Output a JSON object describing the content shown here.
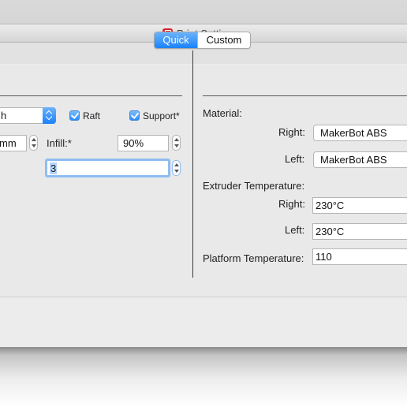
{
  "window": {
    "title": "Print Settings",
    "app_icon": "makerbot-app-icon"
  },
  "tabs": {
    "quick": "Quick",
    "custom": "Custom",
    "selected": "Quick"
  },
  "left": {
    "quality_select": "h",
    "raft_label": "Raft",
    "raft_checked": true,
    "support_label": "Support*",
    "support_checked": true,
    "layer_height_value": "mm",
    "infill_label": "Infill:*",
    "infill_value": "90%",
    "shells_value": "3"
  },
  "right": {
    "material_label": "Material:",
    "material_right_label": "Right:",
    "material_right_value": "MakerBot ABS",
    "material_left_label": "Left:",
    "material_left_value": "MakerBot ABS",
    "extruder_temp_label": "Extruder Temperature:",
    "extruder_right_label": "Right:",
    "extruder_right_value": "230°C",
    "extruder_left_label": "Left:",
    "extruder_left_value": "230°C",
    "platform_temp_label": "Platform Temperature:",
    "platform_temp_value": "110"
  },
  "colors": {
    "accent": "#1a82fb",
    "checkbox": "#2a8dfb",
    "app_icon": "#d6232b"
  }
}
